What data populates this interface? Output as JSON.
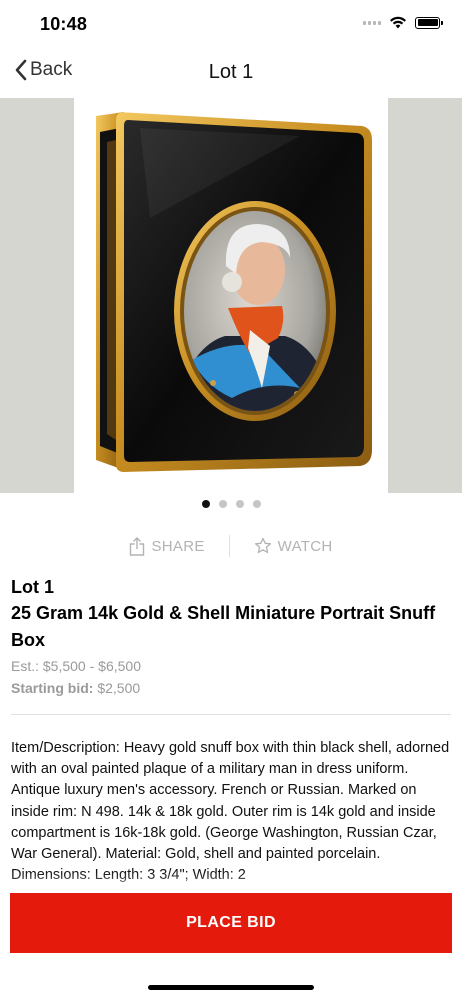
{
  "status_bar": {
    "time": "10:48"
  },
  "nav": {
    "back_label": "Back",
    "title": "Lot 1"
  },
  "carousel": {
    "total_images": 4,
    "active_index": 0
  },
  "actions": {
    "share_label": "SHARE",
    "watch_label": "WATCH"
  },
  "lot": {
    "label": "Lot 1",
    "title": "25 Gram 14k Gold & Shell Miniature Portrait Snuff Box",
    "estimate": "Est.: $5,500 - $6,500",
    "starting_bid_label": "Starting bid:",
    "starting_bid_value": "$2,500"
  },
  "description": "Item/Description: Heavy gold snuff box with thin black shell, adorned with an oval painted plaque of a military man in dress uniform. Antique luxury men's accessory. French or Russian. Marked on inside rim: N 498. 14k & 18k gold. Outer rim is 14k gold and inside compartment is 16k-18k gold. (George Washington, Russian Czar, War General). Material: Gold, shell and painted porcelain. Dimensions: Length: 3 3/4\"; Width: 2",
  "place_bid_label": "PLACE BID",
  "colors": {
    "accent": "#e41b0c",
    "muted_text": "#9a9a9a",
    "hero_background": "#d6d6d0"
  },
  "icons": {
    "back": "chevron-left-icon",
    "share": "share-icon",
    "watch": "star-outline-icon"
  }
}
